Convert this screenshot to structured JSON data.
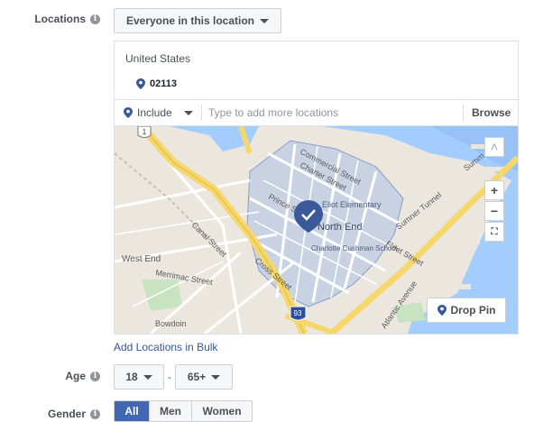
{
  "locations": {
    "label": "Locations",
    "info_icon": "i",
    "mode": "Everyone in this location",
    "country": "United States",
    "items": [
      {
        "label": "02113"
      }
    ],
    "include_label": "Include",
    "search_placeholder": "Type to add more locations",
    "browse_label": "Browse",
    "map": {
      "labels": {
        "commercial_st": "Commercial Street",
        "charter_st": "Charter Street",
        "prince_st": "Prince Street",
        "eliot": "Eliot Elementary",
        "north_end": "North End",
        "charlotte_school": "Charlotte Cushman School",
        "fleet_st": "Fleet Street",
        "canal_st": "Canal Street",
        "west_end": "West End",
        "merrimac_st": "Merrimac Street",
        "cross_st": "Cross Street",
        "atlantic_ave": "Atlantic Avenue",
        "sumner_tunnel": "Sumner Tunnel",
        "summer": "Summ",
        "bowdoin": "Bowdoin",
        "route_1": "1",
        "route_93": "93"
      },
      "zoom_in": "+",
      "zoom_out": "−",
      "drop_pin_label": "Drop Pin"
    },
    "bulk_link": "Add Locations in Bulk"
  },
  "age": {
    "label": "Age",
    "min": "18",
    "separator": "-",
    "max": "65+"
  },
  "gender": {
    "label": "Gender",
    "options": [
      "All",
      "Men",
      "Women"
    ],
    "selected": "All"
  },
  "colors": {
    "accent": "#4267b2",
    "water": "#a3ccff",
    "highlight": "#c9d2e3",
    "highway": "#f5d76e",
    "pin": "#3b5998"
  }
}
